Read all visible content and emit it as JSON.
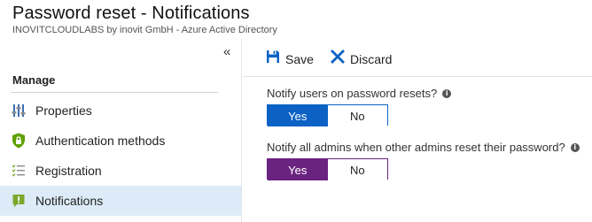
{
  "header": {
    "title": "Password reset - Notifications",
    "subtitle": "INOVITCLOUDLABS by inovit GmbH - Azure Active Directory"
  },
  "sidebar": {
    "collapse_glyph": "«",
    "section_label": "Manage",
    "items": [
      {
        "label": "Properties",
        "icon": "sliders-icon",
        "active": false
      },
      {
        "label": "Authentication methods",
        "icon": "shield-lock-icon",
        "active": false
      },
      {
        "label": "Registration",
        "icon": "checklist-icon",
        "active": false
      },
      {
        "label": "Notifications",
        "icon": "notification-icon",
        "active": true
      }
    ]
  },
  "toolbar": {
    "save_label": "Save",
    "discard_label": "Discard"
  },
  "settings": [
    {
      "question": "Notify users on password resets?",
      "yes": "Yes",
      "no": "No",
      "selected": "Yes"
    },
    {
      "question": "Notify all admins when other admins reset their password?",
      "yes": "Yes",
      "no": "No",
      "selected": "Yes"
    }
  ],
  "colors": {
    "accent_blue": "#0b62c4",
    "accent_purple": "#6b2380",
    "active_nav_bg": "#dcebf7"
  }
}
